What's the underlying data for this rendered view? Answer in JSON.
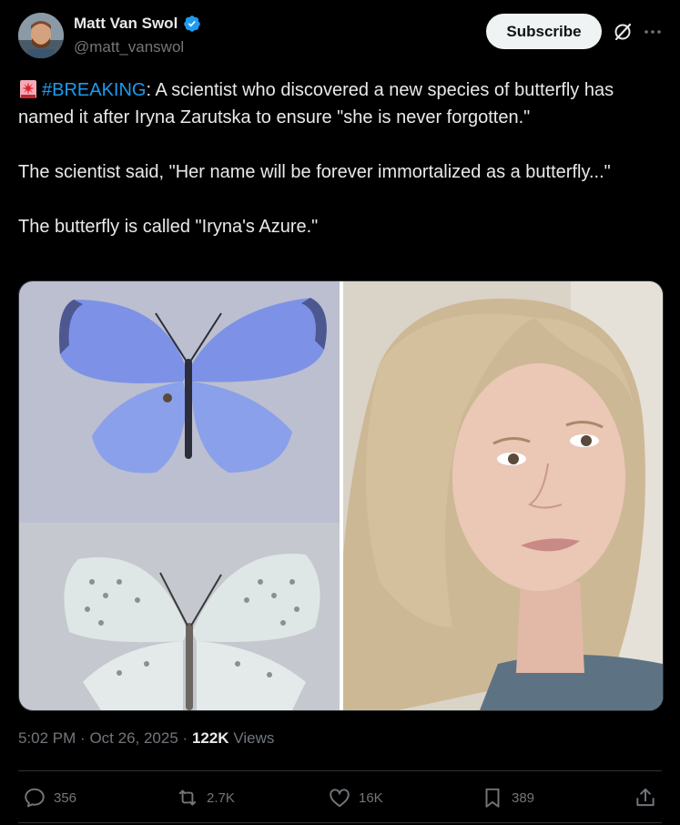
{
  "author": {
    "display_name": "Matt Van Swol",
    "handle": "@matt_vanswol",
    "verified": true
  },
  "header": {
    "subscribe_label": "Subscribe",
    "grok_icon": "grok-icon",
    "more_icon": "more-options-icon"
  },
  "tweet": {
    "siren_icon": "rotating-light-emoji",
    "hashtag": "#BREAKING",
    "line1_rest": ": A scientist who discovered a new species of butterfly has named it after Iryna Zarutska to ensure \"she is never forgotten.\"",
    "paragraph2": "The scientist said, \"Her name will be forever immortalized as a butterfly...\"",
    "paragraph3": "The butterfly is called \"Iryna's Azure.\""
  },
  "meta": {
    "time": "5:02 PM",
    "dot1": "·",
    "date": "Oct 26, 2025",
    "dot2": "·",
    "views_count": "122K",
    "views_label": "Views"
  },
  "actions": {
    "replies": "356",
    "reposts": "2.7K",
    "likes": "16K",
    "bookmarks": "389"
  },
  "colors": {
    "background": "#000000",
    "text": "#e7e9ea",
    "muted": "#71767b",
    "link": "#1d9bf0",
    "verified": "#1d9bf0"
  }
}
